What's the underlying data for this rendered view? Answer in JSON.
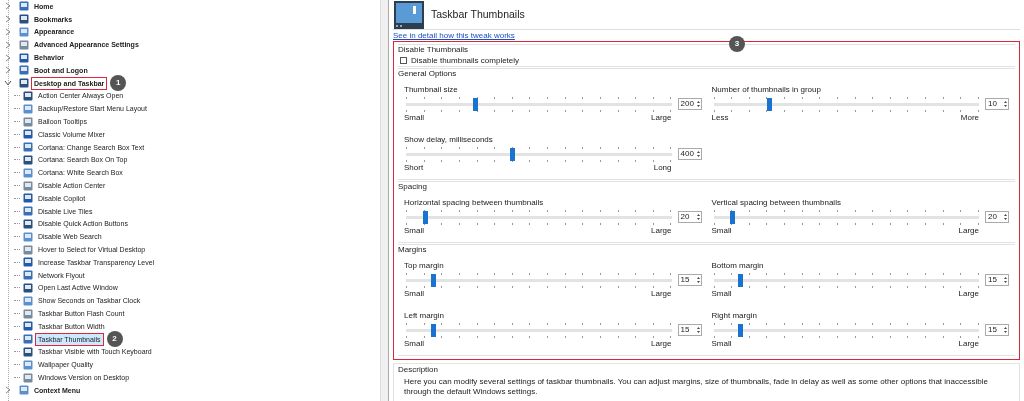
{
  "tree": [
    {
      "label": "Home",
      "expanded": false,
      "selected": false,
      "highlighted": false
    },
    {
      "label": "Bookmarks",
      "expanded": false,
      "selected": false,
      "highlighted": false
    },
    {
      "label": "Appearance",
      "expanded": false,
      "selected": false,
      "highlighted": false
    },
    {
      "label": "Advanced Appearance Settings",
      "expanded": false,
      "selected": false,
      "highlighted": false
    },
    {
      "label": "Behavior",
      "expanded": false,
      "selected": false,
      "highlighted": false
    },
    {
      "label": "Boot and Logon",
      "expanded": false,
      "selected": false,
      "highlighted": false
    },
    {
      "label": "Desktop and Taskbar",
      "expanded": true,
      "selected": false,
      "highlighted": true,
      "callout": "1",
      "children": [
        {
          "label": "Action Center Always Open",
          "selected": false,
          "highlighted": false
        },
        {
          "label": "Backup/Restore Start Menu Layout",
          "selected": false,
          "highlighted": false
        },
        {
          "label": "Balloon Tooltips",
          "selected": false,
          "highlighted": false
        },
        {
          "label": "Classic Volume Mixer",
          "selected": false,
          "highlighted": false
        },
        {
          "label": "Cortana: Change Search Box Text",
          "selected": false,
          "highlighted": false
        },
        {
          "label": "Cortana: Search Box On Top",
          "selected": false,
          "highlighted": false
        },
        {
          "label": "Cortana: White Search Box",
          "selected": false,
          "highlighted": false
        },
        {
          "label": "Disable Action Center",
          "selected": false,
          "highlighted": false
        },
        {
          "label": "Disable Copilot",
          "selected": false,
          "highlighted": false
        },
        {
          "label": "Disable Live Tiles",
          "selected": false,
          "highlighted": false
        },
        {
          "label": "Disable Quick Action Buttons",
          "selected": false,
          "highlighted": false
        },
        {
          "label": "Disable Web Search",
          "selected": false,
          "highlighted": false
        },
        {
          "label": "Hover to Select for Virtual Desktop",
          "selected": false,
          "highlighted": false
        },
        {
          "label": "Increase Taskbar Transparency Level",
          "selected": false,
          "highlighted": false
        },
        {
          "label": "Network Flyout",
          "selected": false,
          "highlighted": false
        },
        {
          "label": "Open Last Active Window",
          "selected": false,
          "highlighted": false
        },
        {
          "label": "Show Seconds on Taskbar Clock",
          "selected": false,
          "highlighted": false
        },
        {
          "label": "Taskbar Button Flash Count",
          "selected": false,
          "highlighted": false
        },
        {
          "label": "Taskbar Button Width",
          "selected": false,
          "highlighted": false
        },
        {
          "label": "Taskbar Thumbnails",
          "selected": true,
          "highlighted": true,
          "callout": "2"
        },
        {
          "label": "Taskbar Visible with Touch Keyboard",
          "selected": false,
          "highlighted": false
        },
        {
          "label": "Wallpaper Quality",
          "selected": false,
          "highlighted": false
        },
        {
          "label": "Windows Version on Desktop",
          "selected": false,
          "highlighted": false
        }
      ]
    },
    {
      "label": "Context Menu",
      "expanded": false,
      "selected": false,
      "highlighted": false
    }
  ],
  "page": {
    "title": "Taskbar Thumbnails",
    "link": "See in detail how this tweak works",
    "callout": "3",
    "sections": [
      {
        "title": "Disable Thumbnails",
        "kind": "checkboxes",
        "items": [
          {
            "label": "Disable thumbnails completely",
            "checked": false
          }
        ]
      },
      {
        "title": "General Options",
        "kind": "sliders",
        "sliders": [
          {
            "label": "Thumbnail size",
            "level": 0.26,
            "value": "200",
            "min_label": "Small",
            "max_label": "Large"
          },
          {
            "label": "Number of thumbnails in group",
            "level": 0.21,
            "value": "10",
            "min_label": "Less",
            "max_label": "More"
          },
          {
            "label": "Show delay, milliseconds",
            "level": 0.4,
            "value": "400",
            "min_label": "Short",
            "max_label": "Long"
          }
        ]
      },
      {
        "title": "Spacing",
        "kind": "sliders",
        "sliders": [
          {
            "label": "Horizontal spacing between thumbnails",
            "level": 0.07,
            "value": "20",
            "min_label": "Small",
            "max_label": "Large"
          },
          {
            "label": "Vertical spacing between thumbnails",
            "level": 0.07,
            "value": "20",
            "min_label": "Small",
            "max_label": "Large"
          }
        ]
      },
      {
        "title": "Margins",
        "kind": "sliders",
        "sliders": [
          {
            "label": "Top margin",
            "level": 0.1,
            "value": "15",
            "min_label": "Small",
            "max_label": "Large"
          },
          {
            "label": "Bottom margin",
            "level": 0.1,
            "value": "15",
            "min_label": "Small",
            "max_label": "Large"
          },
          {
            "label": "Left margin",
            "level": 0.1,
            "value": "15",
            "min_label": "Small",
            "max_label": "Large"
          },
          {
            "label": "Right margin",
            "level": 0.1,
            "value": "15",
            "min_label": "Small",
            "max_label": "Large"
          }
        ]
      }
    ],
    "description": {
      "title": "Description",
      "text": "Here you can modify several settings of taskbar thumbnails. You can adjust margins, size of thumbnails, fade in delay as well as some other options that inaccessible through the default Windows settings."
    }
  }
}
